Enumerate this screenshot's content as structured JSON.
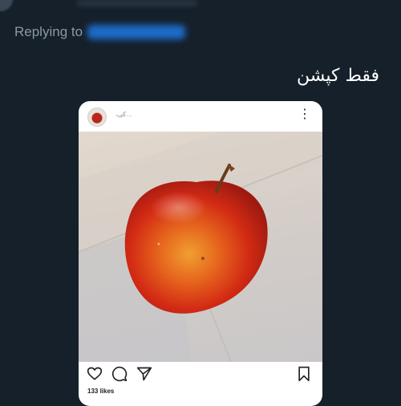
{
  "reply": {
    "label": "Replying to"
  },
  "tweet": {
    "caption": "فقط کپشن"
  },
  "post": {
    "username": "،کی…",
    "likes": "133 likes"
  },
  "icons": {
    "menu": "more-vertical-icon",
    "like": "heart-icon",
    "comment": "comment-icon",
    "share": "send-icon",
    "save": "bookmark-icon"
  },
  "colors": {
    "background": "#15202b",
    "muted_text": "#8b98a5",
    "link_blue": "#1d6bc7",
    "card": "#ffffff"
  }
}
